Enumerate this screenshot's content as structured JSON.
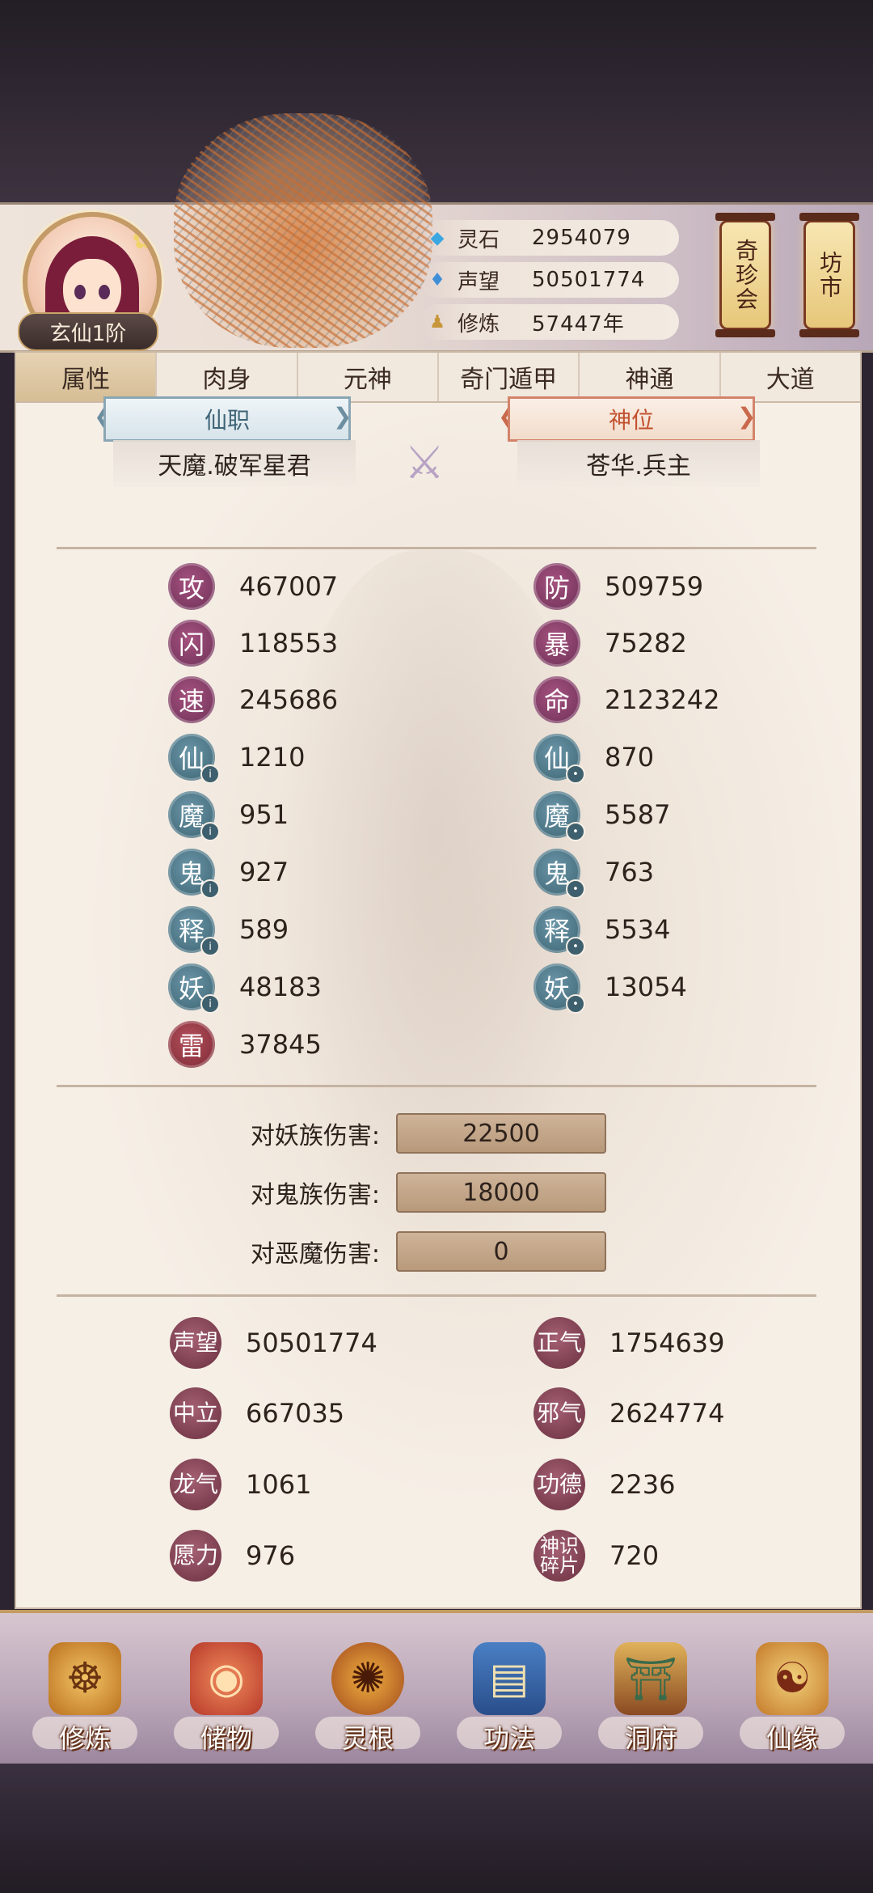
{
  "header": {
    "rank": "玄仙1阶",
    "resources": [
      {
        "icon": "spirit-stone-icon",
        "label": "灵石",
        "value": "2954079"
      },
      {
        "icon": "reputation-crystal-icon",
        "label": "声望",
        "value": "50501774"
      },
      {
        "icon": "cultivation-figure-icon",
        "label": "修炼",
        "value": "57447年"
      }
    ],
    "lanterns": [
      "奇珍会",
      "坊市"
    ]
  },
  "tabs": [
    "属性",
    "肉身",
    "元神",
    "奇门遁甲",
    "神通",
    "大道"
  ],
  "active_tab": "属性",
  "titles": {
    "left_header": "仙职",
    "left_value": "天魔.破军星君",
    "right_header": "神位",
    "right_value": "苍华.兵主"
  },
  "stats_left": [
    {
      "badge": "攻",
      "value": "467007"
    },
    {
      "badge": "闪",
      "value": "118553"
    },
    {
      "badge": "速",
      "value": "245686"
    },
    {
      "badge": "仙",
      "value": "1210"
    },
    {
      "badge": "魔",
      "value": "951"
    },
    {
      "badge": "鬼",
      "value": "927"
    },
    {
      "badge": "释",
      "value": "589"
    },
    {
      "badge": "妖",
      "value": "48183"
    },
    {
      "badge": "雷",
      "value": "37845"
    }
  ],
  "stats_right": [
    {
      "badge": "防",
      "value": "509759"
    },
    {
      "badge": "暴",
      "value": "75282"
    },
    {
      "badge": "命",
      "value": "2123242"
    },
    {
      "badge": "仙",
      "value": "870"
    },
    {
      "badge": "魔",
      "value": "5587"
    },
    {
      "badge": "鬼",
      "value": "763"
    },
    {
      "badge": "释",
      "value": "5534"
    },
    {
      "badge": "妖",
      "value": "13054"
    }
  ],
  "damage": [
    {
      "label": "对妖族伤害:",
      "value": "22500"
    },
    {
      "label": "对鬼族伤害:",
      "value": "18000"
    },
    {
      "label": "对恶魔伤害:",
      "value": "0"
    }
  ],
  "alignment": [
    {
      "label": "声望",
      "value": "50501774"
    },
    {
      "label": "正气",
      "value": "1754639"
    },
    {
      "label": "中立",
      "value": "667035"
    },
    {
      "label": "邪气",
      "value": "2624774"
    },
    {
      "label": "龙气",
      "value": "1061"
    },
    {
      "label": "功德",
      "value": "2236"
    },
    {
      "label": "愿力",
      "value": "976"
    },
    {
      "label_lines": [
        "神识",
        "碎片"
      ],
      "value": "720"
    }
  ],
  "bottom_nav": [
    {
      "label": "修炼",
      "icon": "meditating-monk-icon"
    },
    {
      "label": "储物",
      "icon": "treasure-bag-icon"
    },
    {
      "label": "灵根",
      "icon": "spirit-root-swirl-icon"
    },
    {
      "label": "功法",
      "icon": "scripture-book-icon"
    },
    {
      "label": "洞府",
      "icon": "cave-palace-icon"
    },
    {
      "label": "仙缘",
      "icon": "gourd-icon"
    }
  ]
}
